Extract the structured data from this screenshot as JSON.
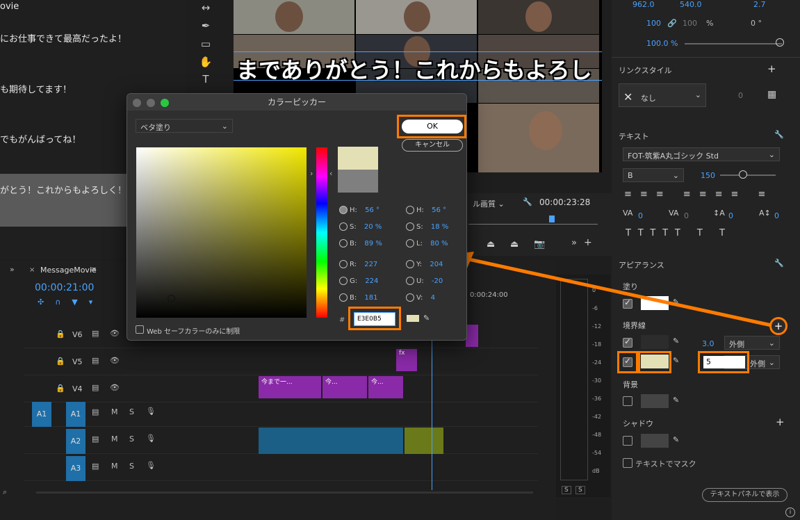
{
  "transcript": {
    "lines": [
      "ovie",
      "にお仕事できて最高だったよ！",
      "も期待してます！",
      "でもがんばってね！",
      "がとう！これからもよろしく！"
    ]
  },
  "program": {
    "caption": "までありがとう！これからもよろし",
    "quality_label": "ル画質",
    "timecode": "00:00:23:28"
  },
  "right_panel": {
    "position_x": "962.0",
    "position_y": "540.0",
    "anchor_val": "2.7",
    "scale_w": "100",
    "scale_h": "100",
    "scale_unit": "%",
    "rotation": "0 °",
    "opacity": "100.0 %",
    "link_style_header": "リンクスタイル",
    "link_style_value": "なし",
    "link_count": "0",
    "text_header": "テキスト",
    "font_family": "FOT-筑紫A丸ゴシック Std",
    "font_style": "B",
    "font_size": "150",
    "tracking_vals": [
      "0",
      "0",
      "0",
      "0"
    ],
    "appearance_header": "アピアランス",
    "fill_label": "塗り",
    "stroke_label": "境界線",
    "stroke_width_1": "3.0",
    "stroke_pos_1": "外側",
    "stroke_width_2": "5",
    "stroke_pos_2": "外側",
    "background_label": "背景",
    "shadow_label": "シャドウ",
    "mask_label": "テキストでマスク",
    "show_in_panel": "テキストパネルで表示",
    "colors": {
      "fill": "#ffffff",
      "stroke1": "#2c2c2c",
      "stroke2": "#e3e0b5",
      "accent": "#ff7b00"
    }
  },
  "timeline": {
    "sequence_name": "MessageMovie",
    "timecode": "00:00:21:00",
    "ruler_time": "0:00:24:00",
    "tracks_video": [
      "V6",
      "V5",
      "V4"
    ],
    "tracks_audio": [
      "A1",
      "A2",
      "A3"
    ],
    "clip_labels": [
      "今まで一...",
      "今...",
      "今..."
    ],
    "fx_label": "fx",
    "m_label": "M",
    "s_label": "S"
  },
  "meter": {
    "ticks": [
      "0",
      "-6",
      "-12",
      "-18",
      "-24",
      "-30",
      "-36",
      "-42",
      "-48",
      "-54",
      "dB"
    ],
    "solo_labels": [
      "S",
      "S"
    ]
  },
  "dialog": {
    "title": "カラーピッカー",
    "fill_mode": "ベタ塗り",
    "ok_label": "OK",
    "cancel_label": "キャンセル",
    "hsb": {
      "h": "56 °",
      "s": "20 %",
      "b": "89 %"
    },
    "hsl": {
      "h": "56 °",
      "s": "18 %",
      "l": "80 %"
    },
    "rgb": {
      "r": "227",
      "g": "224",
      "b": "181"
    },
    "yuv": {
      "y": "204",
      "u": "-20",
      "v": "4"
    },
    "hex": "E3E0B5",
    "hash": "#",
    "web_safe": "Web セーフカラーのみに制限",
    "new_color": "#e3e0b5",
    "old_color": "#7f7f7f"
  }
}
